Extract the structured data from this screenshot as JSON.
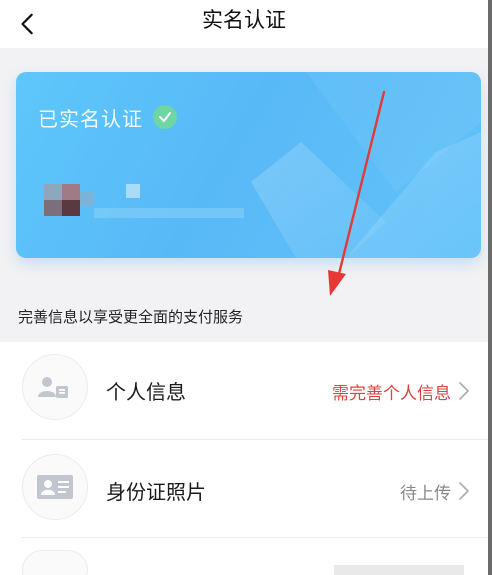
{
  "header": {
    "title": "实名认证",
    "back_icon": "chevron-left-icon"
  },
  "card": {
    "verified_label": "已实名认证",
    "verified_icon": "check-circle-icon",
    "colors": {
      "start": "#5ec7fb",
      "end": "#58b9f7",
      "check": "#6fd6a3"
    }
  },
  "subtitle": "完善信息以享受更全面的支付服务",
  "list": {
    "items": [
      {
        "label": "个人信息",
        "status": "需完善个人信息",
        "status_color": "#e0423d",
        "icon": "person-card-icon"
      },
      {
        "label": "身份证照片",
        "status": "待上传",
        "status_color": "#8a8a8a",
        "icon": "id-card-icon"
      }
    ]
  },
  "annotation": {
    "color": "#e53935",
    "icon": "red-arrow"
  }
}
